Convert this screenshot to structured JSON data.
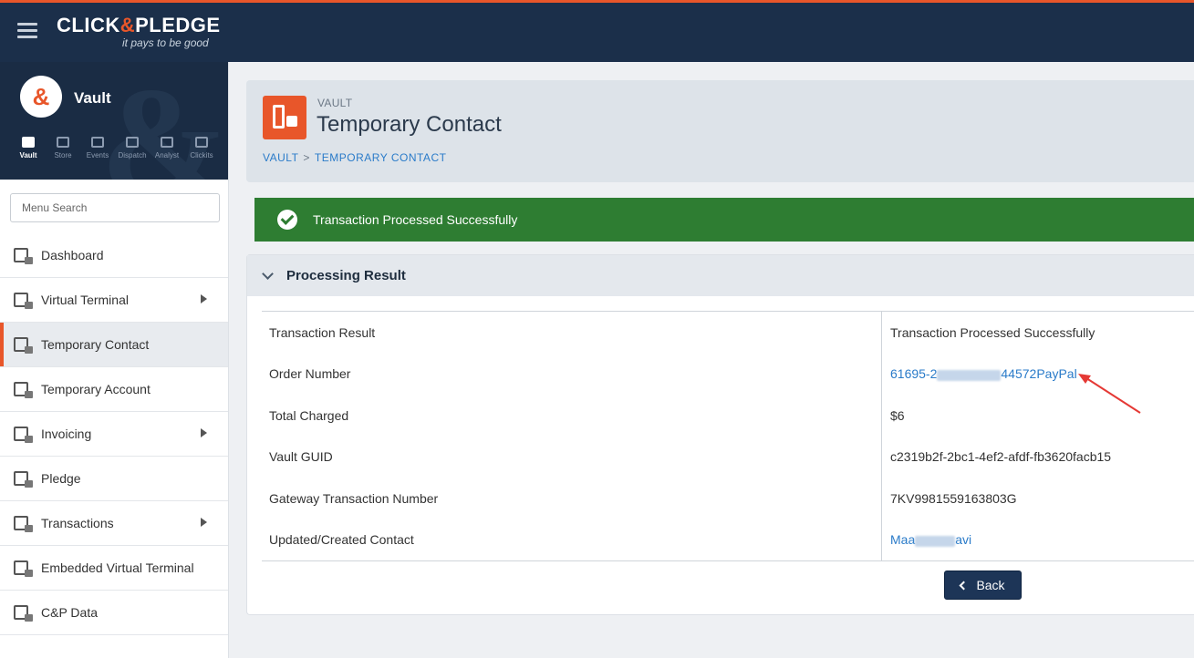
{
  "brand": {
    "name_left": "CLICK",
    "name_amp": "&",
    "name_right": "PLEDGE",
    "tagline": "it pays to be good"
  },
  "sidebar": {
    "module_title": "Vault",
    "logo_char": "&",
    "apps": [
      {
        "label": "Vault"
      },
      {
        "label": "Store"
      },
      {
        "label": "Events"
      },
      {
        "label": "Dispatch"
      },
      {
        "label": "Analyst"
      },
      {
        "label": "Clickits"
      }
    ],
    "search_placeholder": "Menu Search",
    "items": [
      {
        "label": "Dashboard"
      },
      {
        "label": "Virtual Terminal"
      },
      {
        "label": "Temporary Contact"
      },
      {
        "label": "Temporary Account"
      },
      {
        "label": "Invoicing"
      },
      {
        "label": "Pledge"
      },
      {
        "label": "Transactions"
      },
      {
        "label": "Embedded Virtual Terminal"
      },
      {
        "label": "C&P Data"
      }
    ]
  },
  "header": {
    "kicker": "VAULT",
    "title": "Temporary Contact",
    "breadcrumb": {
      "root": "VAULT",
      "sep": ">",
      "current": "TEMPORARY CONTACT"
    }
  },
  "alert": {
    "message": "Transaction Processed Successfully"
  },
  "result": {
    "title": "Processing Result",
    "rows": [
      {
        "key": "Transaction Result",
        "value": "Transaction Processed Successfully"
      },
      {
        "key": "Order Number",
        "value_start": "61695-2",
        "value_end": "44572PayPal"
      },
      {
        "key": "Total Charged",
        "value": "$6"
      },
      {
        "key": "Vault GUID",
        "value": "c2319b2f-2bc1-4ef2-afdf-fb3620facb15"
      },
      {
        "key": "Gateway Transaction Number",
        "value": "7KV9981559163803G"
      },
      {
        "key": "Updated/Created Contact",
        "value_start": "Maa",
        "value_end": "avi"
      }
    ],
    "back_label": "Back"
  },
  "colors": {
    "accent": "#e8562a",
    "navy": "#1b2f4a",
    "success": "#2e7d32",
    "link": "#2a7bc9"
  }
}
